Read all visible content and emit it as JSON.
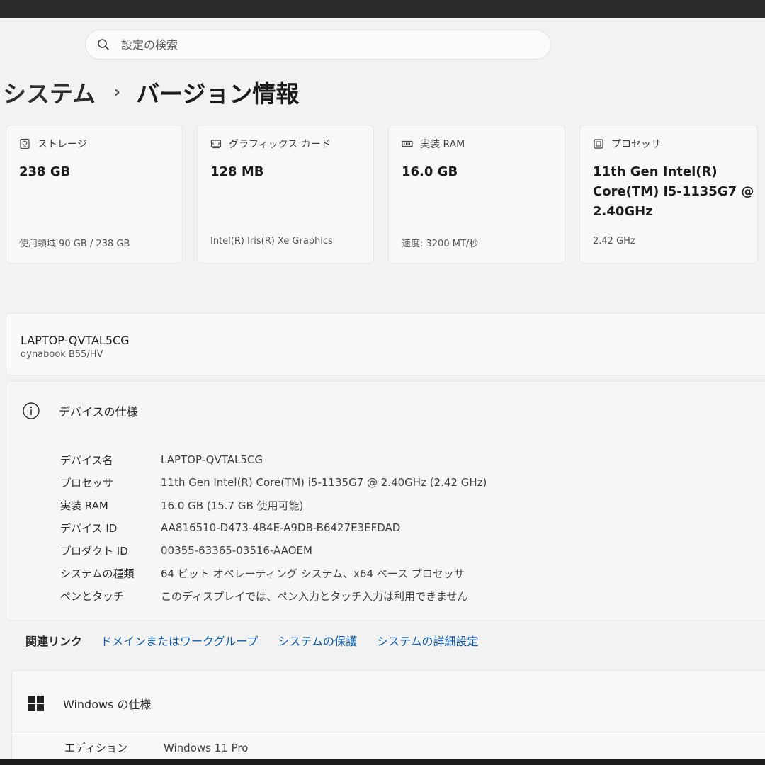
{
  "search": {
    "placeholder": "設定の検索"
  },
  "breadcrumb": {
    "parent": "システム",
    "separator": "›",
    "current": "バージョン情報"
  },
  "cards": [
    {
      "label": "ストレージ",
      "value": "238 GB",
      "sub": "使用領域 90 GB / 238 GB",
      "icon": "storage-icon"
    },
    {
      "label": "グラフィックス カード",
      "value": "128 MB",
      "sub": "Intel(R) Iris(R) Xe Graphics",
      "icon": "graphics-card-icon"
    },
    {
      "label": "実装 RAM",
      "value": "16.0 GB",
      "sub": "速度: 3200 MT/秒",
      "icon": "ram-icon"
    },
    {
      "label": "プロセッサ",
      "value_lines": [
        "11th Gen Intel(R)",
        "Core(TM) i5-1135G7 @",
        "2.40GHz"
      ],
      "sub": "2.42 GHz",
      "icon": "processor-icon"
    }
  ],
  "device": {
    "name": "LAPTOP-QVTAL5CG",
    "model": "dynabook B55/HV"
  },
  "spec": {
    "title": "デバイスの仕様",
    "rows": [
      {
        "key": "デバイス名",
        "value": "LAPTOP-QVTAL5CG"
      },
      {
        "key": "プロセッサ",
        "value": "11th Gen Intel(R) Core(TM) i5-1135G7 @ 2.40GHz (2.42 GHz)"
      },
      {
        "key": "実装 RAM",
        "value": "16.0 GB (15.7 GB 使用可能)"
      },
      {
        "key": "デバイス ID",
        "value": "AA816510-D473-4B4E-A9DB-B6427E3EFDAD"
      },
      {
        "key": "プロダクト ID",
        "value": "00355-63365-03516-AAOEM"
      },
      {
        "key": "システムの種類",
        "value": "64 ビット オペレーティング システム、x64 ベース プロセッサ"
      },
      {
        "key": "ペンとタッチ",
        "value": "このディスプレイでは、ペン入力とタッチ入力は利用できません"
      }
    ]
  },
  "related": {
    "label": "関連リンク",
    "links": [
      "ドメインまたはワークグループ",
      "システムの保護",
      "システムの詳細設定"
    ]
  },
  "windows": {
    "title": "Windows の仕様",
    "rows": [
      {
        "key": "エディション",
        "value": "Windows 11 Pro"
      }
    ]
  },
  "colors": {
    "link": "#0b5cad",
    "background": "#f2f2f2",
    "card": "#f8f8f8"
  }
}
